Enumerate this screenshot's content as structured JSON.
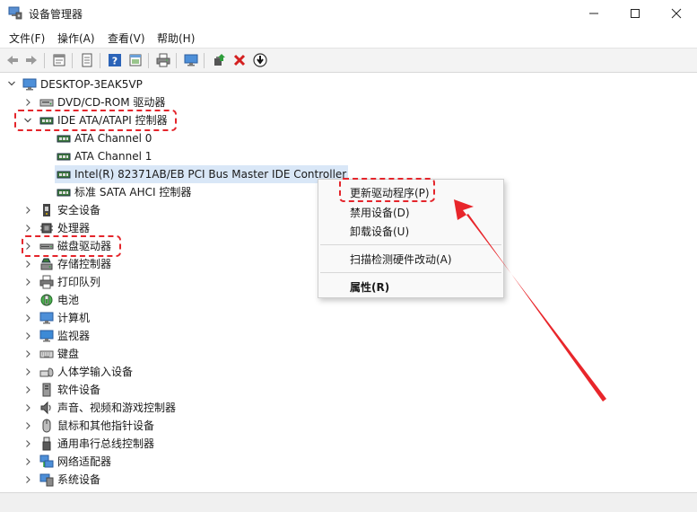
{
  "window": {
    "title": "设备管理器",
    "icon": "device-manager-icon"
  },
  "menu": [
    {
      "label": "文件(F)"
    },
    {
      "label": "操作(A)"
    },
    {
      "label": "查看(V)"
    },
    {
      "label": "帮助(H)"
    }
  ],
  "toolbar": {
    "icons": [
      "back-arrow-icon",
      "forward-arrow-icon",
      "properties-icon",
      "show-hidden-icon",
      "help-icon",
      "action-icon",
      "print-icon",
      "monitor-icon",
      "update-driver-icon",
      "uninstall-icon",
      "download-icon"
    ]
  },
  "tree": {
    "root": "DESKTOP-3EAK5VP",
    "items": [
      {
        "label": "DVD/CD-ROM 驱动器",
        "icon": "dvd-drive-icon"
      },
      {
        "label": "IDE ATA/ATAPI 控制器",
        "icon": "ide-controller-icon",
        "expanded": true
      },
      {
        "label": "ATA Channel 0",
        "icon": "ide-channel-icon"
      },
      {
        "label": "ATA Channel 1",
        "icon": "ide-channel-icon"
      },
      {
        "label": "Intel(R) 82371AB/EB PCI Bus Master IDE Controller",
        "icon": "ide-channel-icon",
        "selected": true
      },
      {
        "label": "标准 SATA AHCI 控制器",
        "icon": "ide-channel-icon"
      },
      {
        "label": "安全设备",
        "icon": "security-device-icon"
      },
      {
        "label": "处理器",
        "icon": "processor-icon"
      },
      {
        "label": "磁盘驱动器",
        "icon": "disk-drive-icon"
      },
      {
        "label": "存储控制器",
        "icon": "storage-controller-icon"
      },
      {
        "label": "打印队列",
        "icon": "print-queue-icon"
      },
      {
        "label": "电池",
        "icon": "battery-icon"
      },
      {
        "label": "计算机",
        "icon": "computer-icon"
      },
      {
        "label": "监视器",
        "icon": "monitor-icon"
      },
      {
        "label": "键盘",
        "icon": "keyboard-icon"
      },
      {
        "label": "人体学输入设备",
        "icon": "hid-icon"
      },
      {
        "label": "软件设备",
        "icon": "software-device-icon"
      },
      {
        "label": "声音、视频和游戏控制器",
        "icon": "sound-icon"
      },
      {
        "label": "鼠标和其他指针设备",
        "icon": "mouse-icon"
      },
      {
        "label": "通用串行总线控制器",
        "icon": "usb-icon"
      },
      {
        "label": "网络适配器",
        "icon": "network-adapter-icon"
      },
      {
        "label": "系统设备",
        "icon": "system-device-icon"
      }
    ]
  },
  "context_menu": {
    "items": [
      {
        "label": "更新驱动程序(P)",
        "highlighted": true
      },
      {
        "label": "禁用设备(D)"
      },
      {
        "label": "卸载设备(U)"
      },
      {
        "label": "扫描检测硬件改动(A)"
      },
      {
        "label": "属性(R)",
        "bold": true
      }
    ]
  },
  "annotations": {
    "highlight_color": "#e4252b",
    "arrow_color": "#e8262b"
  }
}
